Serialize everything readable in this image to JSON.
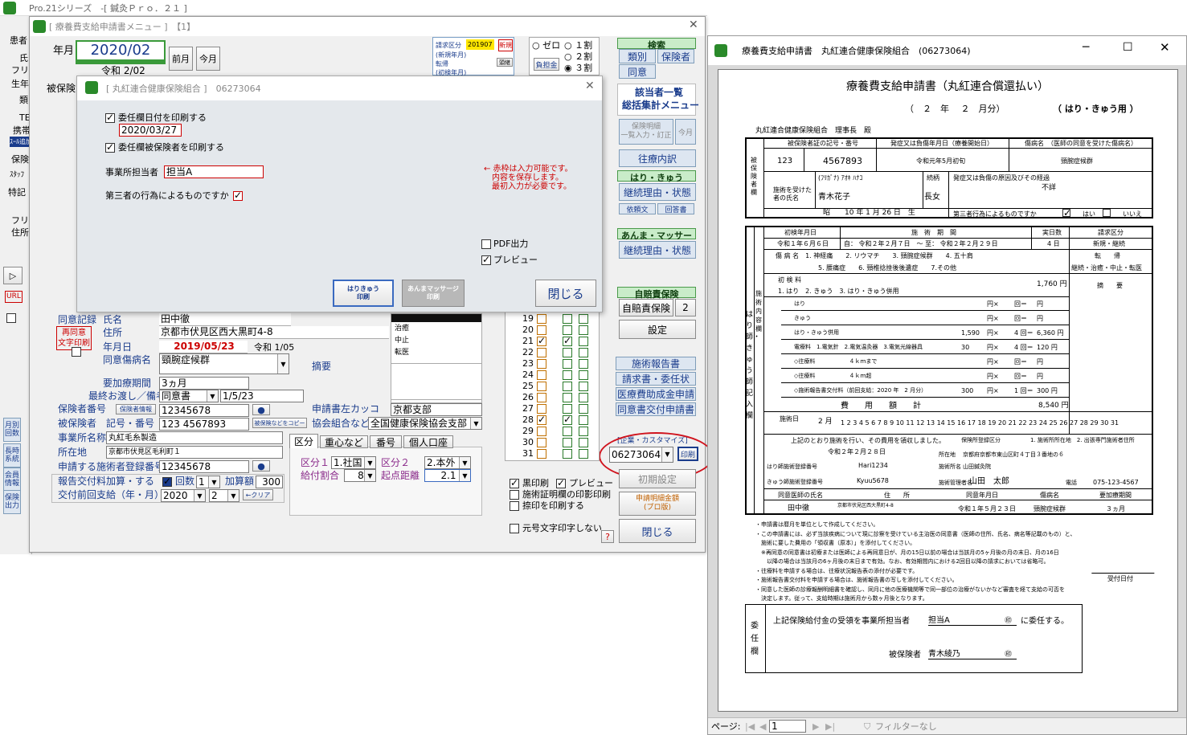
{
  "bg": {
    "app_title": "Pro.21シリーズ　-[ 鍼灸Ｐｒｏ．２１ ]",
    "left_labels": [
      "患者",
      "氏",
      "フリ",
      "生年",
      "類",
      "TE",
      "携帯",
      "ｽｰﾙ追加",
      "保険",
      "ｽﾀｯﾌ",
      "特記",
      "フリ",
      "住所",
      "URL"
    ],
    "side_buttons": [
      "月別回数",
      "長時系統",
      "会員情報",
      "保険出力"
    ]
  },
  "main": {
    "title": "[ 療養費支給申請書メニュー ]　【1】",
    "year_month_label": "年月",
    "year_month": "2020/02",
    "reiwa": "令和 2/02",
    "prev_month": "前月",
    "this_month": "今月",
    "hihoken_label": "被保険",
    "seikyu_kubun": "請求区分",
    "seikyu_val": "201907",
    "shinki": "新規",
    "shinki_label": "(新規年月)",
    "tenki": "転帰",
    "tenki_btn": "頭継",
    "shoshin": "(初検年月)",
    "radios": [
      "ゼロ",
      "１割",
      "２割",
      "３割"
    ],
    "futan": "負担金",
    "kensaku": "検索",
    "ruibetsu": "類別",
    "hokensha": "保険者",
    "doui": "同意",
    "gaitou": "該当者一覧",
    "soukatsu": "総括集計メニュー",
    "hoken_meisai": "保険明細\n一覧入力・訂正",
    "kongetsu": "今月",
    "ouryou": "往療内訳",
    "hari_kyu": "はり・きゅう",
    "keizoku1": "継続理由・状態",
    "irai": "依頼文",
    "kaitou": "回答書",
    "anma": "あんま・マッサージ",
    "keizoku2": "継続理由・状態",
    "jibai_head": "自賠責保険",
    "jibai": "自賠責保険",
    "jibai_n": "2",
    "settei": "設定",
    "shijutsu": "施術報告書",
    "seikyusho": "請求書・委任状",
    "iryouhi": "医療費助成金申請",
    "douisho": "同意書交付申請書",
    "kigyou": "[企業・カスタマイズ]",
    "kigyou_val": "06273064",
    "insatsu": "印刷",
    "shoki": "初期設定",
    "shinsei_kin": "申請明細金額\n(プロ版)",
    "close": "閉じる",
    "kuro": "黒印刷",
    "preview": "プレビュー",
    "shomei": "施術証明欄の印影印刷",
    "inkan": "捺印を印刷する",
    "gengo": "元号文字印字しない",
    "q": "?",
    "days": [
      "19",
      "20",
      "21",
      "22",
      "23",
      "24",
      "25",
      "26",
      "27",
      "28",
      "29",
      "30",
      "31"
    ],
    "list_items": [
      "治癒",
      "中止",
      "転医"
    ],
    "form": {
      "saido_label": "再同意\n文字印刷",
      "doui_kiroku": "同意記録",
      "shimei": "氏名",
      "shimei_v": "田中徹",
      "jusho": "住所",
      "jusho_v": "京都市伏見区西大黒町4-8",
      "nengappi": "年月日",
      "nengappi_v": "2019/05/23",
      "reiwa_v": "令和 1/05",
      "byoumei": "同意傷病名",
      "byoumei_v": "頸腕症候群",
      "tekiyou": "摘要",
      "kikan": "要加療期間",
      "kikan_v": "3ヵ月",
      "saishu": "最終お渡し／備考",
      "saishu_v": "同意書",
      "saishu_d": "1/5/23",
      "hokensha_no": "保険者番号",
      "hokensha_btn": "保険者情報",
      "hokensha_v": "12345678",
      "shinsei_saki": "申請書左カッコ",
      "shinsei_saki_v": "京都支部",
      "hihoken": "被保険者　記号・番号",
      "hihoken_btn": "被保険などをコピー",
      "hihoken_v": "123 4567893",
      "kyokai": "協会組合など",
      "kyokai_v": "全国健康保険協会支部",
      "jigyousho": "事業所名称",
      "jigyousho_v": "丸紅毛糸製造",
      "shozai": "所在地",
      "shozai_v": "京都市伏見区毛利町１",
      "sejutsu_no": "申請する施術者登録番号",
      "sejutsu_v": "12345678",
      "houkoku": "報告交付料加算・する",
      "kaisu": "回数",
      "kaisu_v": "1",
      "kasan": "加算額",
      "kasan_v": "300",
      "koufu": "交付前回支給（年・月）",
      "koufu_y": "2020",
      "koufu_m": "2",
      "clear": "←クリア",
      "tabs": [
        "区分",
        "重心など",
        "番号",
        "個人口座"
      ],
      "kubun1": "区分１",
      "kubun1_v": "1.社国",
      "kubun2": "区分２",
      "kubun2_v": "2.本外",
      "kyufu": "給付割合",
      "kyufu_v": "8",
      "kiten": "起点距離",
      "kiten_v": "2.1"
    }
  },
  "dialog": {
    "title": "[ 丸紅連合健康保険組合 ]　06273064",
    "cb1": "委任欄日付を印刷する",
    "date": "2020/03/27",
    "cb2": "委任欄被保険者を印刷する",
    "tantou_label": "事業所担当者",
    "tantou": "担当A",
    "daisan": "第三者の行為によるものですか",
    "note": "← 赤枠は入力可能です。\n　内容を保存します。\n　最初入力が必要です。",
    "pdf": "PDF出力",
    "preview": "プレビュー",
    "btn1": "はりきゅう\n印刷",
    "btn2": "あんまマッサージ\n印刷",
    "close": "閉じる"
  },
  "preview": {
    "title": "療養費支給申請書　丸紅連合健康保険組合　(06273064)",
    "doc_title": "療養費支給申請書（丸紅連合償還払い）",
    "period": "（　２　年　 ２　月分）",
    "kind": "（ はり・きゅう用 ）",
    "addressee": "丸紅連合健康保険組合　理事長　殿",
    "h_kigou": "被保険者証の記号・番号",
    "h_hassei": "発症又は負傷年月日（療養開始日）",
    "h_byoumei": "傷病名　（医師の同意を受けた傷病名）",
    "kigou": "123",
    "bangou": "4567893",
    "hassei": "令和元年5月初旬",
    "byoumei": "頸腕症候群",
    "furigana": "(ﾌﾘｶﾞﾅ) ｱｵｷ ﾊﾅｺ",
    "zokugara": "続柄",
    "keika": "発症又は負傷の原因及びその経過",
    "patient_label": "施術を受けた者の氏名",
    "patient": "青木花子",
    "relation": "長女",
    "fusho": "不詳",
    "birth": "昭　　10 年 1 月 26 日　生",
    "third": "第三者行為によるものですか",
    "hai": "はい",
    "iie": "いいえ",
    "left_side": "はり師・きゅう師記入欄",
    "r_shoken": "初検年月日",
    "r_kikan": "施　術　期　間",
    "r_jitsu": "実日数",
    "r_seikyu": "請求区分",
    "shoken": "令和１年６月６日",
    "kikan": "自： 令和２年２月７日　～ 至： 令和２年２月２９日",
    "jitsu": "4 日",
    "shinki": "新規・継続",
    "byoumei_row": "傷 病 名　1. 神経痛　　2. リウマチ　　3. 頸腕症候群　　4. 五十肩",
    "byoumei_row2": "5. 腰痛症　　6. 頸椎捻挫後後遺症　　7.その他",
    "tenki": "転　　帰",
    "tenki_v": "継続・治癒・中止・転医",
    "shoken_ryo": "初 検 料",
    "shoken_ryo2": "1. はり　2. きゅう　3. はり・きゅう併用",
    "shoken_ryo_v": "1,760 円",
    "tekiyou": "摘　　要",
    "rows": [
      {
        "name": "はり",
        "a": "",
        "b": "円×",
        "c": "回＝",
        "d": "円"
      },
      {
        "name": "きゅう",
        "a": "",
        "b": "円×",
        "c": "回＝",
        "d": "円"
      },
      {
        "name": "はり・きゅう併用",
        "a": "1,590",
        "b": "円×",
        "c": "4 回＝",
        "d": "6,360 円"
      },
      {
        "name": "電療料　1.電気針　2.電気温灸器　3.電気光線器具",
        "a": "30",
        "b": "円×",
        "c": "4 回＝",
        "d": "120 円"
      },
      {
        "name": "◇往療料　　　　　　４ｋｍまで",
        "a": "",
        "b": "円×",
        "c": "回＝",
        "d": "円"
      },
      {
        "name": "◇往療料　　　　　　４ｋｍ超",
        "a": "",
        "b": "円×",
        "c": "回＝",
        "d": "円"
      },
      {
        "name": "◇施術報告書交付料（前回支給：2020 年　2 月分）",
        "a": "300",
        "b": "円×",
        "c": "1 回＝",
        "d": "300 円"
      }
    ],
    "hiyou": "費　　用　　額　　計",
    "hiyou_v": "8,540 円",
    "sejutsubi": "施術日",
    "month": "2 月",
    "days_str": "1 2 3 4 5 6 7 8 9 10 11 12 13 14 15 16 17 18 19 20 21 22 23 24 25 26 27 28 29 30 31",
    "shoumei": "上記のとおり施術を行い、その費用を領収しました。",
    "shoumei_date": "令和２年２月２８日",
    "hoken_kubun": "保険所登録区分",
    "kubun_opts": "1. 施術所所在地　2. 出張専門施術者住所",
    "jusho": "所在地",
    "jusho_v": "京都府京都市東山区町４丁目３番地の６",
    "hari_no": "はり師施術登録番号",
    "hari_v": "Hari1234",
    "kyu_no": "きゅう師施術登録番号",
    "kyu_v": "Kyuu5678",
    "meishou": "施術所名",
    "meishou_v": "山田鍼灸院",
    "sejutsusha": "施術管理者名",
    "sejutsusha_v": "山田　太郎",
    "tel": "電話",
    "tel_v": "075-123-4567",
    "d_ishi": "同意医師の氏名",
    "d_jusho": "住　　所",
    "d_date": "同意年月日",
    "d_byou": "傷病名",
    "d_kikan": "要加療期間",
    "ishi": "田中徹",
    "ishi_jusho": "京都市伏見区西大黒町4-8",
    "ishi_date": "令和１年５月２３日",
    "ishi_byou": "頸腕症候群",
    "ishi_kikan": "３ヵ月",
    "notes": [
      "・申請書は暦月を単位として作成してください。",
      "・この申請書には、必ず当該疾病について現に診察を受けている主治医の同意書（医師の住所、氏名、病名等記載のもの）と、",
      "　施術に要した費用の「領収書（原本）」を添付してください。",
      "　※再同意の同意書は初療または医師による再同意日が、月の15日以前の場合は当該月の5ヶ月後の月の末日、月の16日",
      "　　以降の場合は当該月の6ヶ月後の末日まで有効。なお、有効期間内における2回目以降の請求においては省略可。",
      "・往療料を申請する場合は、往療状況報告表の添付が必要です。",
      "・施術報告書交付料を申請する場合は、施術報告書の写しを添付してください。",
      "・同意した医師の診療報酬明細書を確認し、同月に他の医療機関等で同一部位の治療がないかなど審査を経て支給の可否を",
      "　決定します。従って、支給時期は施術月から数ヶ月後となります。"
    ],
    "uketsuke": "受付日付",
    "inin_side": "委任欄",
    "inin": "上記保険給付金の受領を事業所担当者",
    "inin_name": "担当A",
    "inin_tail": "に委任する。",
    "hihokensha": "被保険者",
    "hihokensha_v": "青木綾乃",
    "page_label": "ページ:",
    "page": "1",
    "filter": "フィルターなし"
  }
}
